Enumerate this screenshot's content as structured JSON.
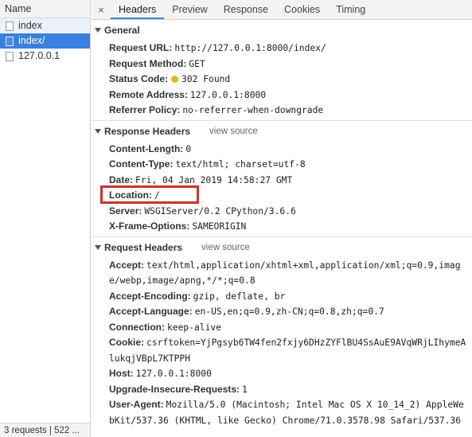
{
  "requests": {
    "header": "Name",
    "items": [
      {
        "label": "index",
        "state": "alt"
      },
      {
        "label": "index/",
        "state": "selected"
      },
      {
        "label": "127.0.0.1",
        "state": ""
      }
    ],
    "footer": "3 requests | 522 ..."
  },
  "tabs": {
    "close": "×",
    "items": [
      "Headers",
      "Preview",
      "Response",
      "Cookies",
      "Timing"
    ],
    "active": "Headers"
  },
  "general": {
    "title": "General",
    "request_url": {
      "key": "Request URL:",
      "value": "http://127.0.0.1:8000/index/"
    },
    "request_method": {
      "key": "Request Method:",
      "value": "GET"
    },
    "status_code": {
      "key": "Status Code:",
      "value": "302 Found",
      "dot_color": "#e6b619"
    },
    "remote_address": {
      "key": "Remote Address:",
      "value": "127.0.0.1:8000"
    },
    "referrer_policy": {
      "key": "Referrer Policy:",
      "value": "no-referrer-when-downgrade"
    }
  },
  "response_headers": {
    "title": "Response Headers",
    "view_source": "view source",
    "content_length": {
      "key": "Content-Length:",
      "value": "0"
    },
    "content_type": {
      "key": "Content-Type:",
      "value": "text/html; charset=utf-8"
    },
    "date": {
      "key": "Date:",
      "value": "Fri, 04 Jan 2019 14:58:27 GMT"
    },
    "location": {
      "key": "Location:",
      "value": "/"
    },
    "server": {
      "key": "Server:",
      "value": "WSGIServer/0.2 CPython/3.6.6"
    },
    "x_frame_options": {
      "key": "X-Frame-Options:",
      "value": "SAMEORIGIN"
    }
  },
  "request_headers": {
    "title": "Request Headers",
    "view_source": "view source",
    "accept": {
      "key": "Accept:",
      "value": "text/html,application/xhtml+xml,application/xml;q=0.9,image/webp,image/apng,*/*;q=0.8"
    },
    "accept_encoding": {
      "key": "Accept-Encoding:",
      "value": "gzip, deflate, br"
    },
    "accept_language": {
      "key": "Accept-Language:",
      "value": "en-US,en;q=0.9,zh-CN;q=0.8,zh;q=0.7"
    },
    "connection": {
      "key": "Connection:",
      "value": "keep-alive"
    },
    "cookie": {
      "key": "Cookie:",
      "value": "csrftoken=YjPgsyb6TW4fen2fxjy6DHzZYFlBU4SsAuE9AVqWRjLIhymeAlukqjVBpL7KTPPH"
    },
    "host": {
      "key": "Host:",
      "value": "127.0.0.1:8000"
    },
    "upgrade_insecure_requests": {
      "key": "Upgrade-Insecure-Requests:",
      "value": "1"
    },
    "user_agent": {
      "key": "User-Agent:",
      "value": "Mozilla/5.0 (Macintosh; Intel Mac OS X 10_14_2) AppleWebKit/537.36 (KHTML, like Gecko) Chrome/71.0.3578.98 Safari/537.36"
    }
  },
  "colors": {
    "selection": "#3b7fdf",
    "highlight_box": "#c9342c"
  }
}
